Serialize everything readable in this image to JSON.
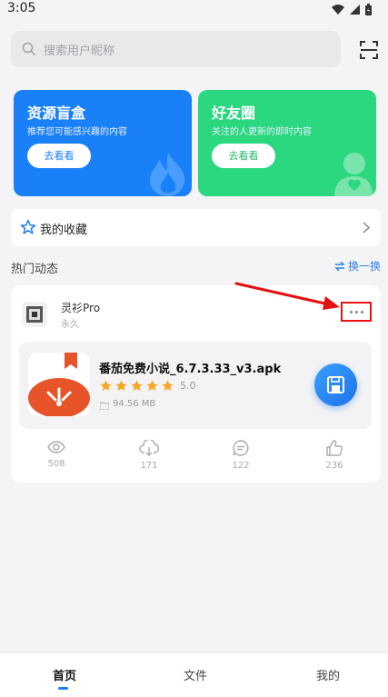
{
  "status_bar": {
    "time": "3:05"
  },
  "search": {
    "placeholder": "搜索用户昵称"
  },
  "cards": [
    {
      "title": "资源盲盒",
      "subtitle": "推荐您可能感兴趣的内容",
      "button": "去看看",
      "color": "#1a80f8"
    },
    {
      "title": "好友圈",
      "subtitle": "关注的人更新的即时内容",
      "button": "去看看",
      "color": "#2bd77f"
    }
  ],
  "favorites": {
    "label": "我的收藏"
  },
  "hot": {
    "title": "热门动态",
    "refresh_label": "换一换"
  },
  "post": {
    "user": "灵衫Pro",
    "user_sub": "永久",
    "file": {
      "name": "番茄免费小说_6.7.3.33_v3.apk",
      "rating": "5.0",
      "stars": 5,
      "size": "94.56 MB"
    },
    "stats": {
      "views": "508",
      "downloads": "171",
      "comments": "122",
      "likes": "236"
    }
  },
  "nav": {
    "home": "首页",
    "files": "文件",
    "mine": "我的"
  },
  "colors": {
    "accent": "#1a80f8",
    "green": "#2bd77f",
    "star": "#f6a623",
    "highlight": "#e11111"
  }
}
